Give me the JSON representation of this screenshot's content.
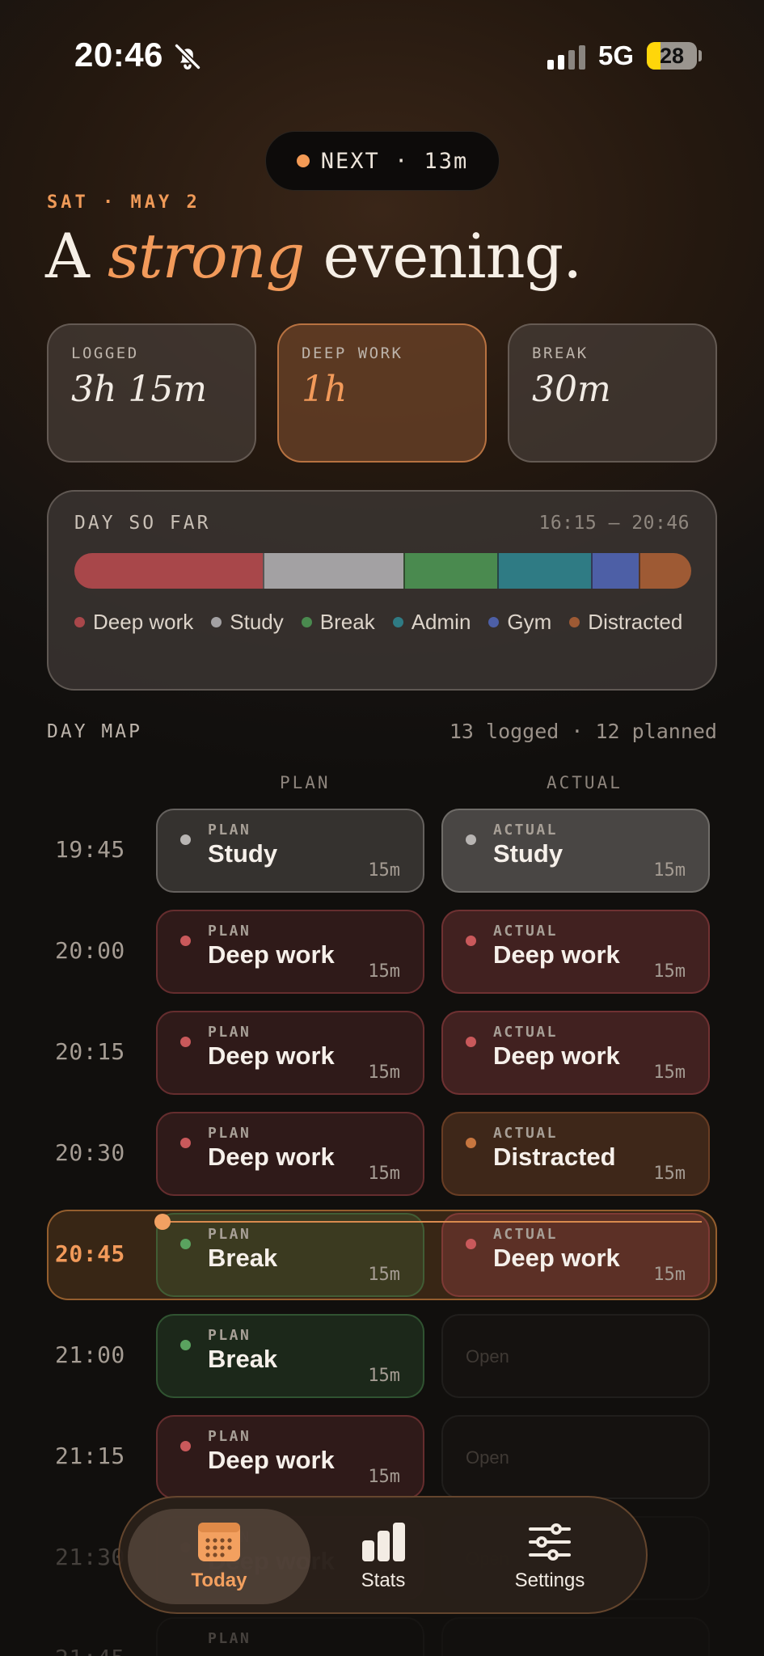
{
  "status_bar": {
    "time": "20:46",
    "network": "5G",
    "battery": "28",
    "battery_level": 0.28
  },
  "next": {
    "label": "NEXT · 13m"
  },
  "date_label": "SAT · MAY 2",
  "headline": {
    "before": "A ",
    "accent": "strong",
    "after": " evening."
  },
  "metrics": [
    {
      "label": "LOGGED",
      "value": "3h 15m"
    },
    {
      "label": "DEEP WORK",
      "value": "1h"
    },
    {
      "label": "BREAK",
      "value": "30m"
    }
  ],
  "day_so_far": {
    "title": "DAY SO FAR",
    "range": "16:15 — 20:46",
    "segments": [
      {
        "category": "Deep work",
        "fraction": 0.305
      },
      {
        "category": "Study",
        "fraction": 0.228
      },
      {
        "category": "Break",
        "fraction": 0.152
      },
      {
        "category": "Admin",
        "fraction": 0.152
      },
      {
        "category": "Gym",
        "fraction": 0.078
      },
      {
        "category": "Distracted",
        "fraction": 0.085
      }
    ]
  },
  "categories": [
    {
      "name": "Deep work",
      "color": "#a8474a"
    },
    {
      "name": "Study",
      "color": "#a3a1a3"
    },
    {
      "name": "Break",
      "color": "#4a8a4f"
    },
    {
      "name": "Admin",
      "color": "#2f7b84"
    },
    {
      "name": "Gym",
      "color": "#4d5fa6"
    },
    {
      "name": "Distracted",
      "color": "#9e5a34"
    }
  ],
  "day_map": {
    "title": "DAY MAP",
    "count": "13 logged · 12 planned",
    "plan_header": "PLAN",
    "actual_header": "ACTUAL",
    "rows": [
      {
        "time": "19:45",
        "plan": {
          "tag": "PLAN",
          "name": "Study",
          "dur": "15m"
        },
        "actual": {
          "tag": "ACTUAL",
          "name": "Study",
          "dur": "15m"
        }
      },
      {
        "time": "20:00",
        "plan": {
          "tag": "PLAN",
          "name": "Deep work",
          "dur": "15m"
        },
        "actual": {
          "tag": "ACTUAL",
          "name": "Deep work",
          "dur": "15m"
        }
      },
      {
        "time": "20:15",
        "plan": {
          "tag": "PLAN",
          "name": "Deep work",
          "dur": "15m"
        },
        "actual": {
          "tag": "ACTUAL",
          "name": "Deep work",
          "dur": "15m"
        }
      },
      {
        "time": "20:30",
        "plan": {
          "tag": "PLAN",
          "name": "Deep work",
          "dur": "15m"
        },
        "actual": {
          "tag": "ACTUAL",
          "name": "Distracted",
          "dur": "15m"
        }
      },
      {
        "time": "20:45",
        "current": true,
        "plan": {
          "tag": "PLAN",
          "name": "Break",
          "dur": "15m"
        },
        "actual": {
          "tag": "ACTUAL",
          "name": "Deep work",
          "dur": "15m"
        }
      },
      {
        "time": "21:00",
        "plan": {
          "tag": "PLAN",
          "name": "Break",
          "dur": "15m"
        },
        "actual": {
          "open": "Open"
        }
      },
      {
        "time": "21:15",
        "plan": {
          "tag": "PLAN",
          "name": "Deep work",
          "dur": "15m"
        },
        "actual": {
          "open": "Open"
        }
      },
      {
        "time": "21:30",
        "plan": {
          "tag": "PLAN",
          "name": "Deep work",
          "dur": "15m"
        },
        "actual": {
          "open": "Open"
        }
      },
      {
        "time": "21:45",
        "plan": {
          "tag": "PLAN",
          "name": "",
          "dur": ""
        },
        "actual": {
          "open": ""
        }
      }
    ]
  },
  "nav": {
    "items": [
      {
        "label": "Today",
        "icon": "calendar-icon",
        "active": true
      },
      {
        "label": "Stats",
        "icon": "bar-chart-icon"
      },
      {
        "label": "Settings",
        "icon": "sliders-icon"
      }
    ]
  },
  "colors": {
    "accent": "#f29a5a"
  }
}
